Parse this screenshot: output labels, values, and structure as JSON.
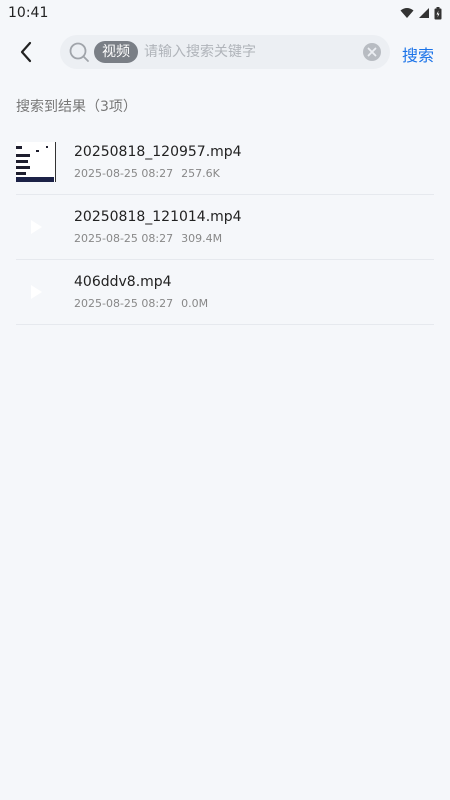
{
  "status": {
    "time": "10:41",
    "icons": [
      "wifi-icon",
      "signal-icon",
      "battery-icon"
    ]
  },
  "search": {
    "back_icon": "chevron-left-icon",
    "search_icon": "search-icon",
    "chip_label": "视频",
    "value": "",
    "placeholder": "请输入搜索关键字",
    "clear_icon": "clear-icon",
    "button_label": "搜索"
  },
  "results": {
    "summary": "搜索到结果（3项）",
    "items": [
      {
        "name": "20250818_120957.mp4",
        "date": "2025-08-25 08:27",
        "size": "257.6K",
        "thumb": "video-thumbnail"
      },
      {
        "name": "20250818_121014.mp4",
        "date": "2025-08-25 08:27",
        "size": "309.4M",
        "thumb": "play-icon"
      },
      {
        "name": "406ddv8.mp4",
        "date": "2025-08-25 08:27",
        "size": "0.0M",
        "thumb": "play-icon"
      }
    ]
  },
  "colors": {
    "accent": "#1b73e8",
    "background": "#f5f7fa",
    "chip": "#7a7f86"
  }
}
